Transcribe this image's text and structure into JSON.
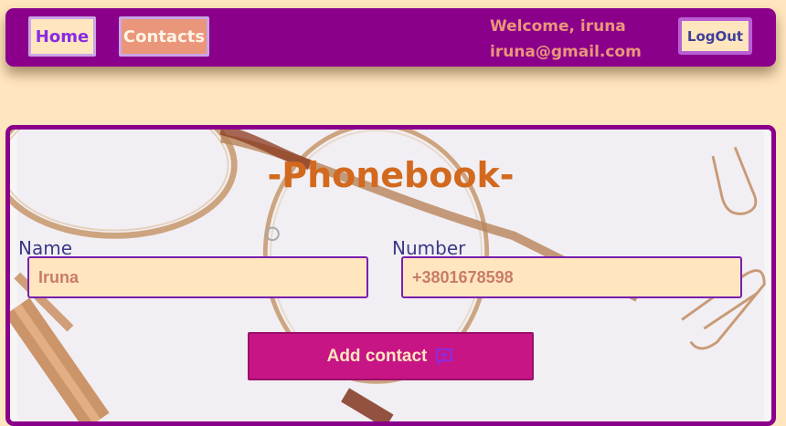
{
  "header": {
    "nav": {
      "home_label": "Home",
      "contacts_label": "Contacts"
    },
    "user": {
      "welcome_text": "Welcome, iruna",
      "email": "iruna@gmail.com"
    },
    "logout_label": "LogOut"
  },
  "phonebook": {
    "title": "-Phonebook-",
    "name_label": "Name",
    "name_value": "Iruna",
    "number_label": "Number",
    "number_value": "+3801678598",
    "add_button_label": "Add contact",
    "add_button_icon": "chat-plus-icon"
  },
  "colors": {
    "header_bg": "#8b008b",
    "page_bg": "#ffe6be",
    "accent_salmon": "#e9967a",
    "title_color": "#d2691e",
    "button_bg": "#c71585",
    "label_color": "#3a3a85"
  }
}
